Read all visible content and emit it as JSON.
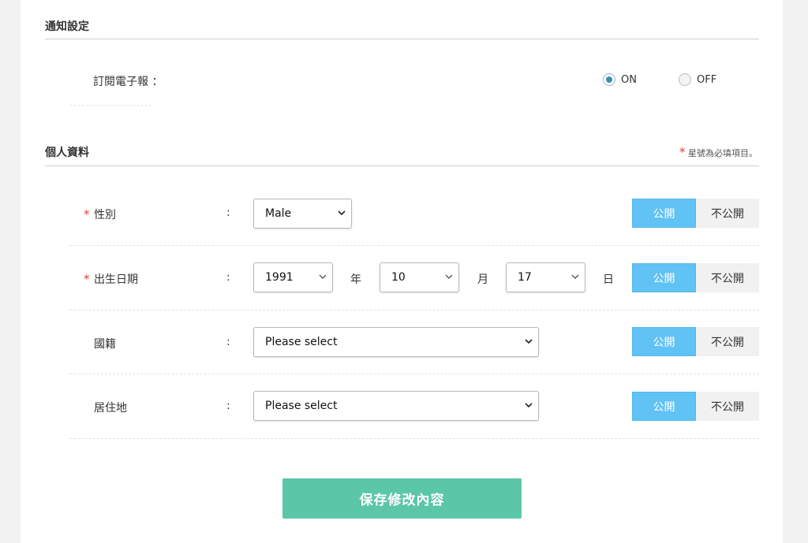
{
  "notification": {
    "title": "通知設定",
    "newsletter_label": "訂閱電子報 ：",
    "on_label": "ON",
    "off_label": "OFF",
    "selected": "ON"
  },
  "profile": {
    "title": "個人資料",
    "required_note": "星號為必填項目。",
    "required_star": "*",
    "colon": ":",
    "public_label": "公開",
    "private_label": "不公開",
    "gender": {
      "label": "性別",
      "value": "Male"
    },
    "birthdate": {
      "label": "出生日期",
      "year": "1991",
      "year_unit": "年",
      "month": "10",
      "month_unit": "月",
      "day": "17",
      "day_unit": "日"
    },
    "nationality": {
      "label": "國籍",
      "value": "Please select"
    },
    "residence": {
      "label": "居住地",
      "value": "Please select"
    }
  },
  "actions": {
    "save_label": "保存修改內容"
  },
  "colors": {
    "accent_blue": "#60c2f5",
    "save_green": "#5cc6a8",
    "required_red": "#e0403a"
  }
}
